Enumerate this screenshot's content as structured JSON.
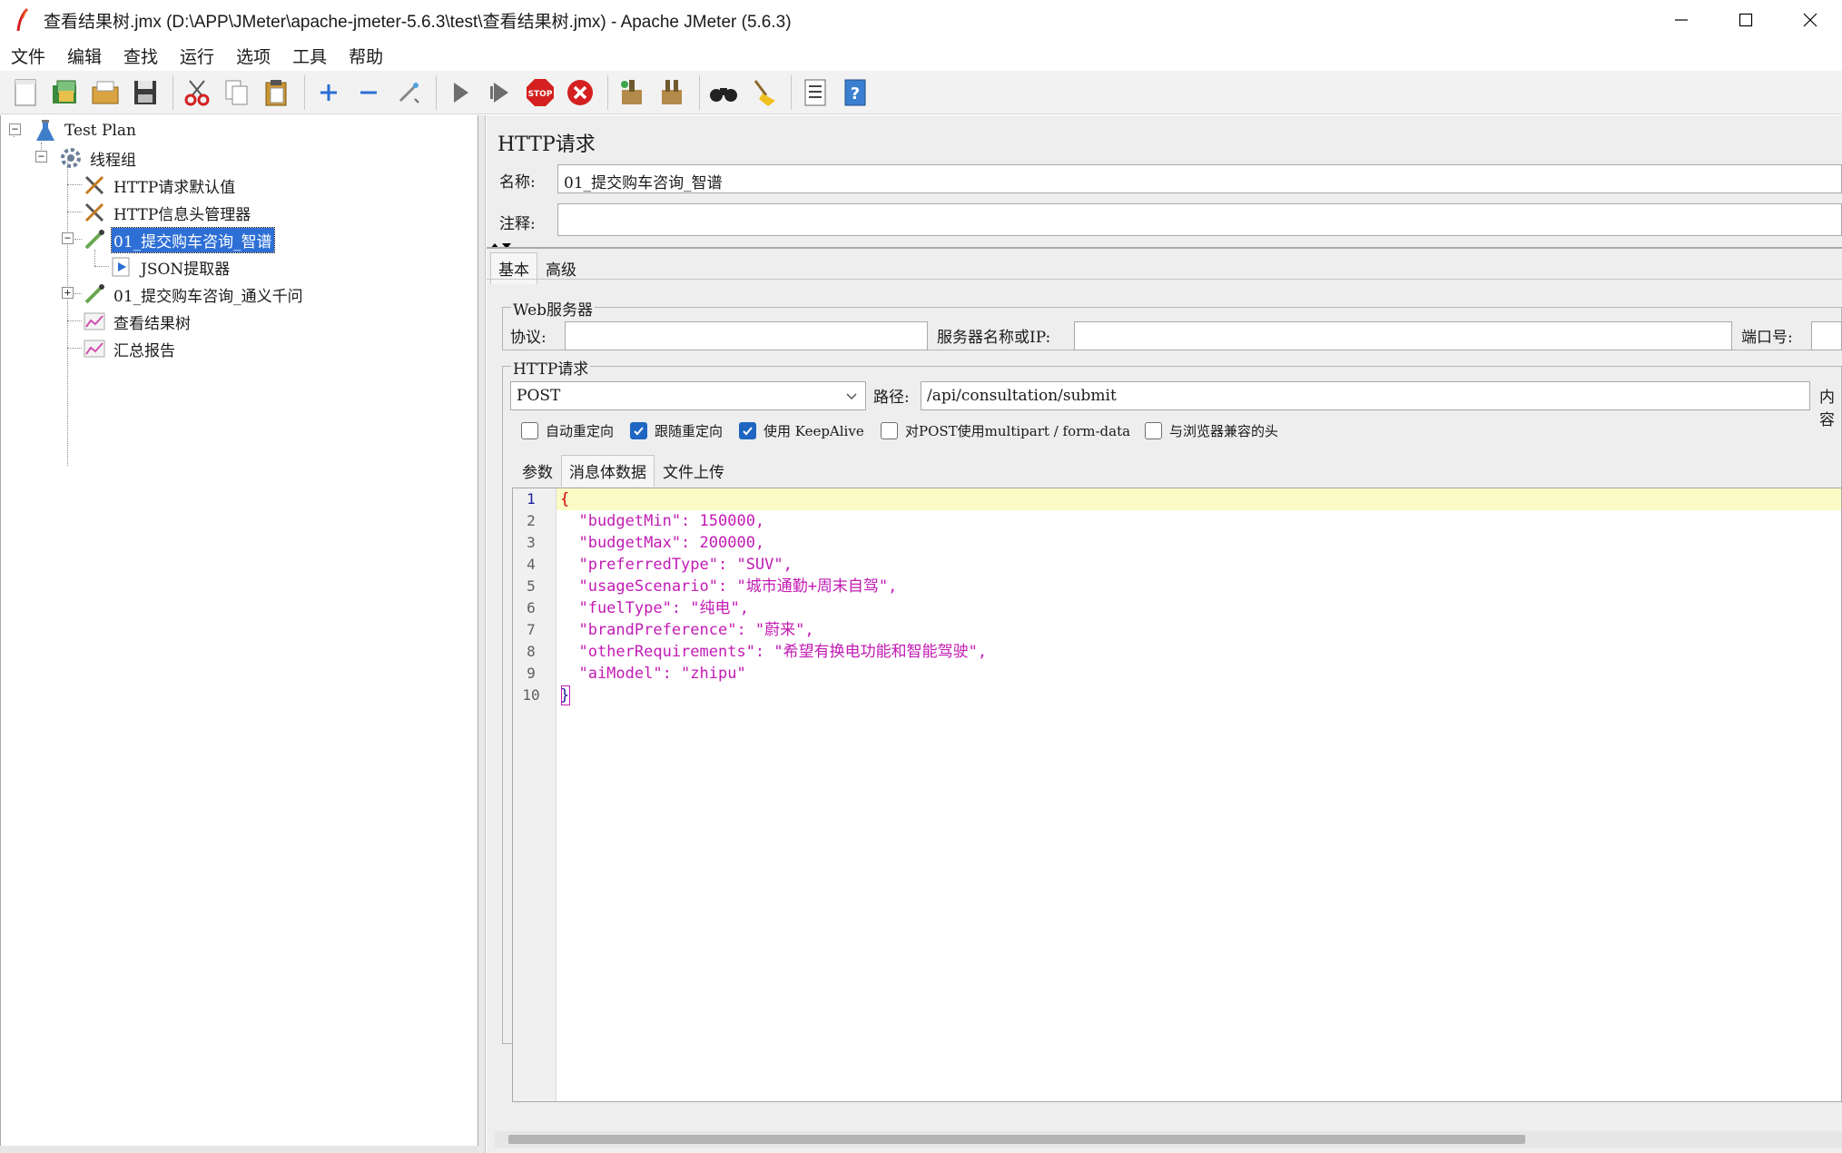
{
  "window": {
    "title": "查看结果树.jmx (D:\\APP\\JMeter\\apache-jmeter-5.6.3\\test\\查看结果树.jmx) - Apache JMeter (5.6.3)"
  },
  "menu": [
    "文件",
    "编辑",
    "查找",
    "运行",
    "选项",
    "工具",
    "帮助"
  ],
  "toolbar": {
    "icons": [
      "new-icon",
      "templates-icon",
      "open-icon",
      "save-icon",
      "cut-icon",
      "copy-icon",
      "paste-icon",
      "expand-icon",
      "collapse-icon",
      "toggle-icon",
      "start-icon",
      "start-no-pause-icon",
      "stop-icon",
      "shutdown-icon",
      "clear-icon",
      "clear-all-icon",
      "search-icon",
      "reset-search-icon",
      "function-helper-icon",
      "help-icon"
    ]
  },
  "tree": {
    "nodes": [
      {
        "label": "Test Plan",
        "icon": "test-plan-icon"
      },
      {
        "label": "线程组",
        "icon": "thread-group-icon"
      },
      {
        "label": "HTTP请求默认值",
        "icon": "config-tool-icon"
      },
      {
        "label": "HTTP信息头管理器",
        "icon": "config-tool-icon"
      },
      {
        "label": "01_提交购车咨询_智谱",
        "icon": "sampler-icon"
      },
      {
        "label": "JSON提取器",
        "icon": "post-processor-icon"
      },
      {
        "label": "01_提交购车咨询_通义千问",
        "icon": "sampler-icon"
      },
      {
        "label": "查看结果树",
        "icon": "listener-icon"
      },
      {
        "label": "汇总报告",
        "icon": "listener-icon"
      }
    ],
    "selected": "01_提交购车咨询_智谱"
  },
  "panel": {
    "title": "HTTP请求",
    "name_label": "名称:",
    "name_value": "01_提交购车咨询_智谱",
    "comment_label": "注释:",
    "comment_value": "",
    "tabs": [
      "基本",
      "高级"
    ],
    "web_server": {
      "title": "Web服务器",
      "protocol_label": "协议:",
      "protocol_value": "",
      "server_label": "服务器名称或IP:",
      "server_value": "",
      "port_label": "端口号:",
      "port_value": ""
    },
    "http_request": {
      "title": "HTTP请求",
      "method": "POST",
      "path_label": "路径:",
      "path_value": "/api/consultation/submit",
      "content_encoding_label": "内容"
    },
    "checkboxes": [
      {
        "label": "自动重定向",
        "checked": false
      },
      {
        "label": "跟随重定向",
        "checked": true
      },
      {
        "label": "使用 KeepAlive",
        "checked": true
      },
      {
        "label": "对POST使用multipart / form-data",
        "checked": false
      },
      {
        "label": "与浏览器兼容的头",
        "checked": false
      }
    ],
    "body_tabs": [
      "参数",
      "消息体数据",
      "文件上传"
    ],
    "body_lines": [
      "{",
      "  \"budgetMin\": 150000,",
      "  \"budgetMax\": 200000,",
      "  \"preferredType\": \"SUV\",",
      "  \"usageScenario\": \"城市通勤+周末自驾\",",
      "  \"fuelType\": \"纯电\",",
      "  \"brandPreference\": \"蔚来\",",
      "  \"otherRequirements\": \"希望有换电功能和智能驾驶\",",
      "  \"aiModel\": \"zhipu\"",
      "}"
    ],
    "line_numbers": [
      "1",
      "2",
      "3",
      "4",
      "5",
      "6",
      "7",
      "8",
      "9",
      "10"
    ]
  }
}
